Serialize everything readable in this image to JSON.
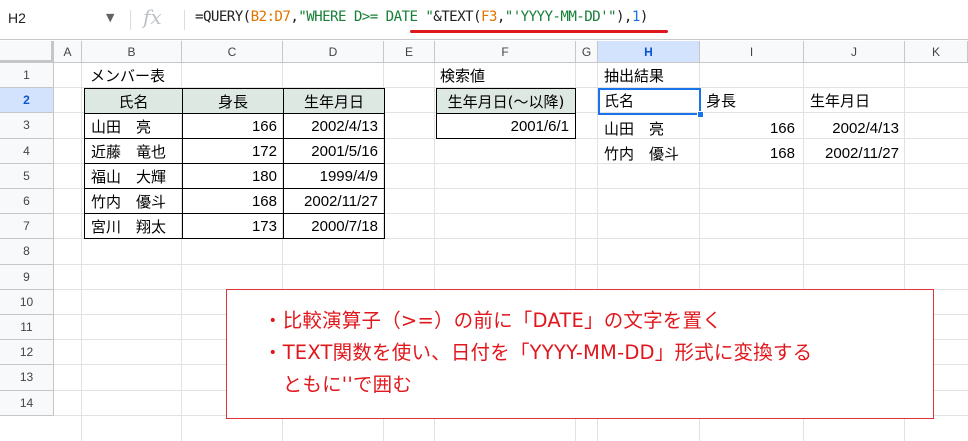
{
  "formula_bar": {
    "name_box": "H2",
    "fx_icon": "fx-icon",
    "formula_parts": [
      {
        "text": "=QUERY(",
        "kind": "fn"
      },
      {
        "text": "B2:D7",
        "kind": "range"
      },
      {
        "text": ",",
        "kind": "fn"
      },
      {
        "text": "\"WHERE D>= DATE \"",
        "kind": "str"
      },
      {
        "text": "&TEXT(",
        "kind": "fn"
      },
      {
        "text": "F3",
        "kind": "range"
      },
      {
        "text": ",",
        "kind": "fn"
      },
      {
        "text": "\"'YYYY-MM-DD'\"",
        "kind": "str"
      },
      {
        "text": "),",
        "kind": "fn"
      },
      {
        "text": "1",
        "kind": "num"
      },
      {
        "text": ")",
        "kind": "fn"
      }
    ]
  },
  "columns": [
    "A",
    "B",
    "C",
    "D",
    "E",
    "F",
    "G",
    "H",
    "I",
    "J",
    "K"
  ],
  "selected_column": "H",
  "rows": [
    "1",
    "2",
    "3",
    "4",
    "5",
    "6",
    "7",
    "8",
    "9",
    "10",
    "11",
    "12",
    "13",
    "14"
  ],
  "selected_row": "2",
  "member_table": {
    "title": "メンバー表",
    "headers": [
      "氏名",
      "身長",
      "生年月日"
    ],
    "rows": [
      [
        "山田　亮",
        "166",
        "2002/4/13"
      ],
      [
        "近藤　竜也",
        "172",
        "2001/5/16"
      ],
      [
        "福山　大輝",
        "180",
        "1999/4/9"
      ],
      [
        "竹内　優斗",
        "168",
        "2002/11/27"
      ],
      [
        "宮川　翔太",
        "173",
        "2000/7/18"
      ]
    ]
  },
  "search": {
    "title": "検索値",
    "header": "生年月日(～以降)",
    "value": "2001/6/1"
  },
  "result": {
    "title": "抽出結果",
    "headers": [
      "氏名",
      "身長",
      "生年月日"
    ],
    "rows": [
      [
        "山田　亮",
        "166",
        "2002/4/13"
      ],
      [
        "竹内　優斗",
        "168",
        "2002/11/27"
      ]
    ]
  },
  "note": {
    "lines": [
      "・比較演算子（>=）の前に「DATE」の文字を置く",
      "・TEXT関数を使い、日付を「YYYY-MM-DD」形式に変換する",
      "　ともに''で囲む"
    ]
  },
  "colors": {
    "accent": "#1a73e8",
    "header_fill": "#dde8e3",
    "annotation": "#e0181d"
  }
}
